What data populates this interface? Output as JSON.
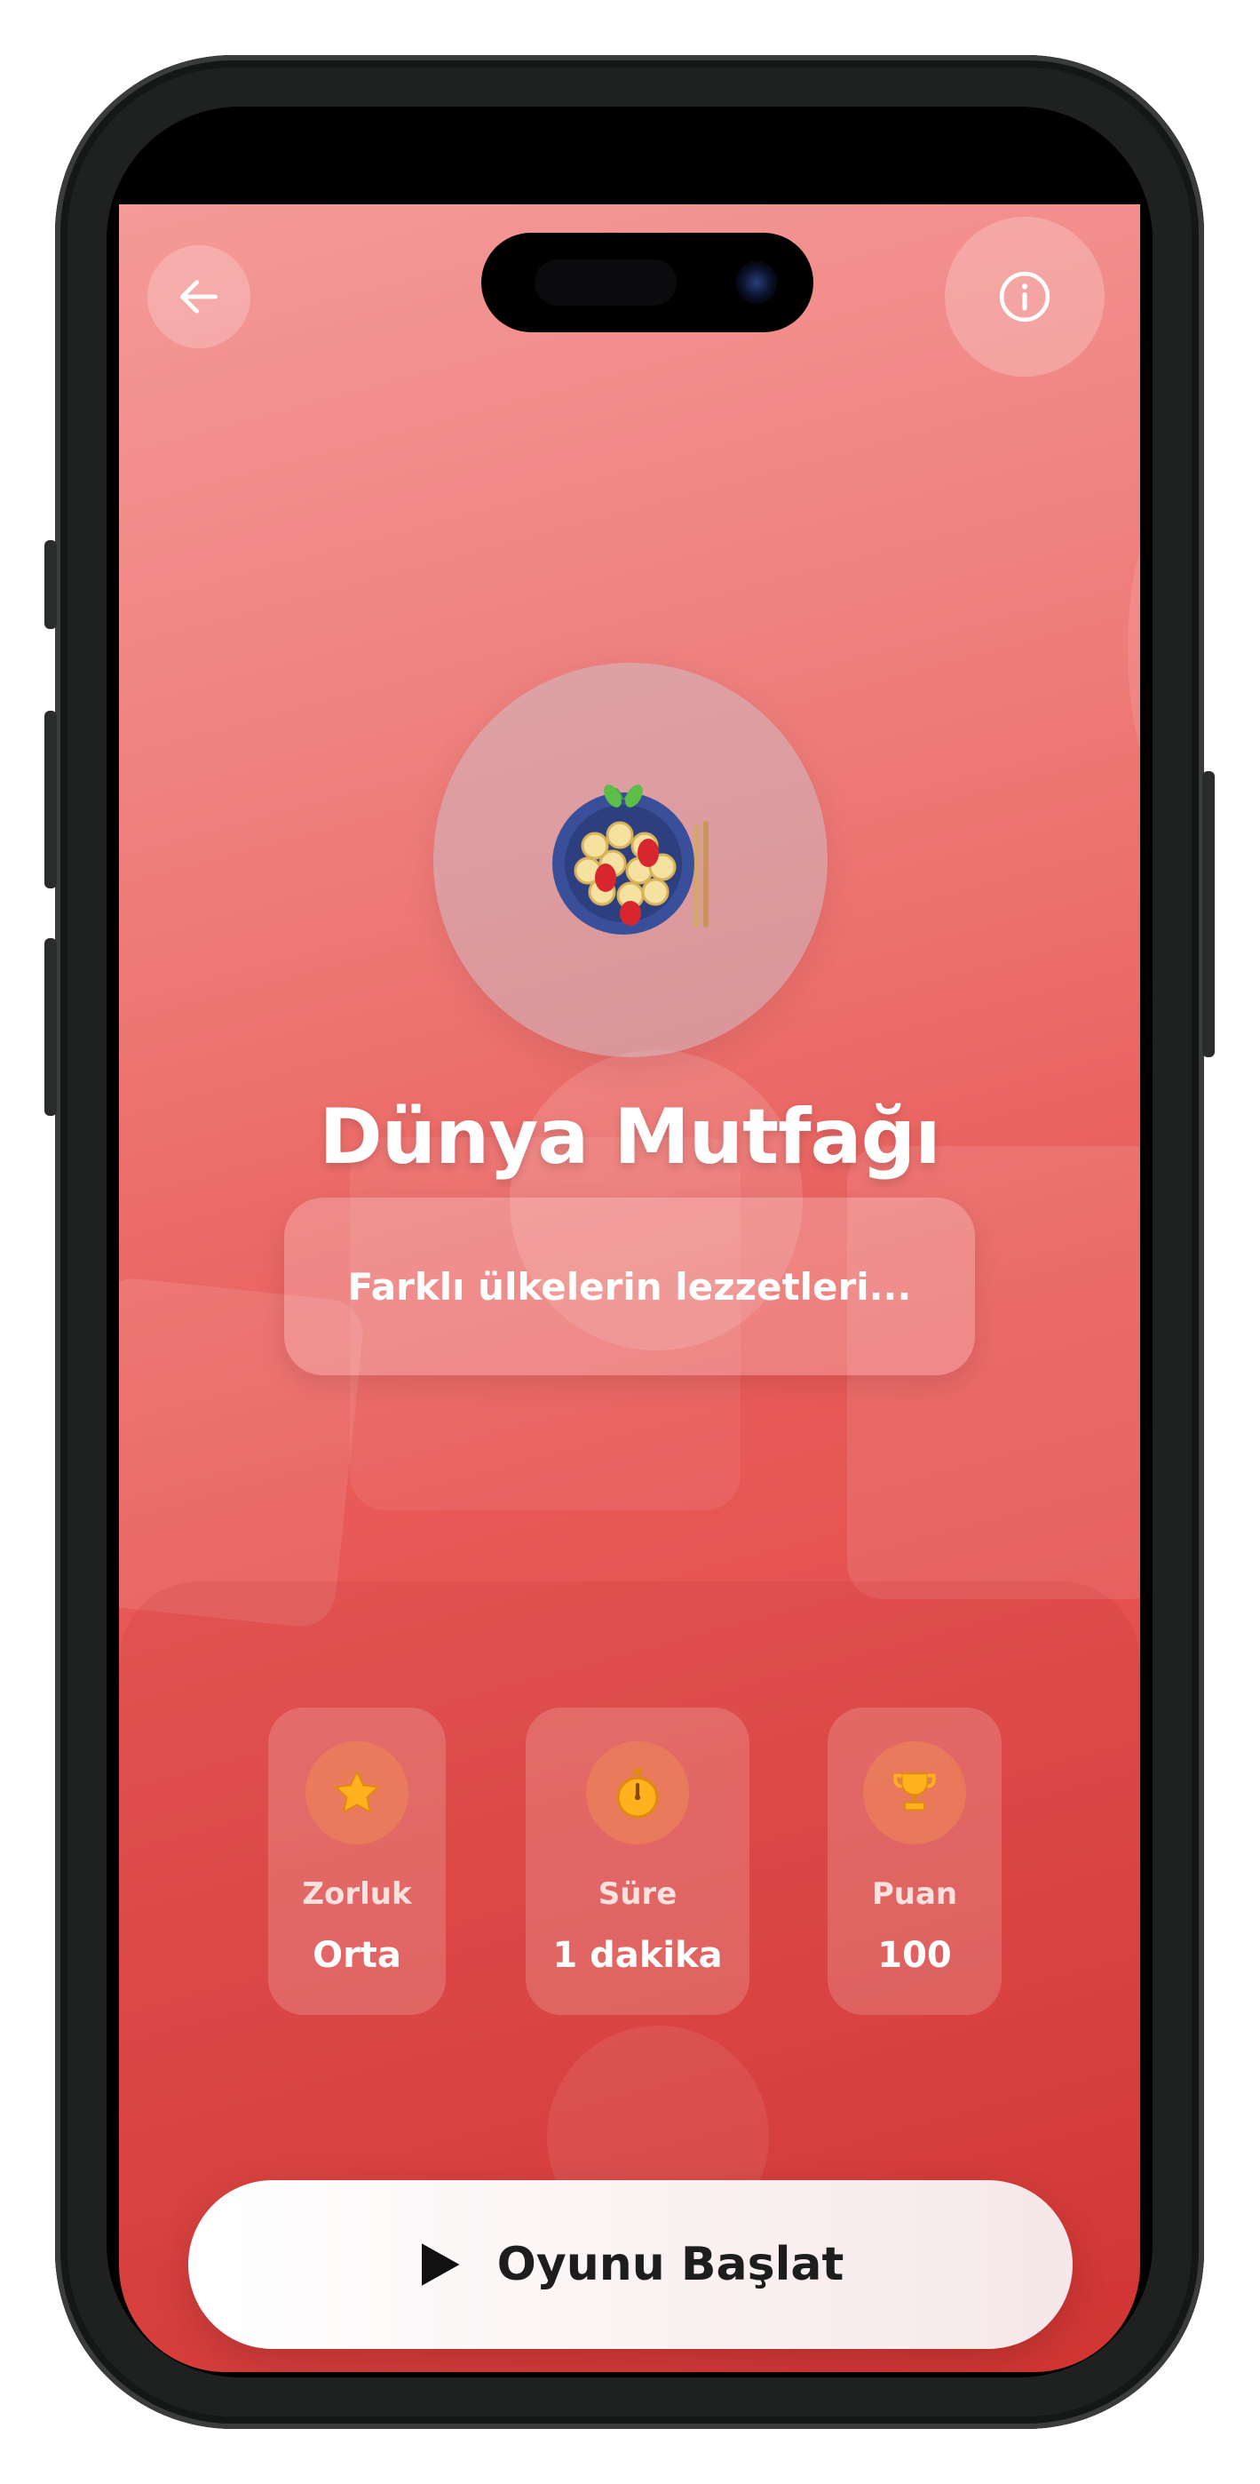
{
  "header": {
    "back_icon": "arrow-left-icon",
    "info_icon": "info-icon"
  },
  "hero": {
    "emoji_icon": "pasta-plate-icon",
    "title": "Dünya Mutfağı",
    "description": "Farklı ülkelerin lezzetleri..."
  },
  "stats": [
    {
      "icon": "star-icon",
      "label": "Zorluk",
      "value": "Orta"
    },
    {
      "icon": "stopwatch-icon",
      "label": "Süre",
      "value": "1 dakika"
    },
    {
      "icon": "trophy-icon",
      "label": "Puan",
      "value": "100"
    }
  ],
  "start_button": {
    "icon": "play-icon",
    "label": "Oyunu Başlat"
  },
  "colors": {
    "gradient_top": "#f49a98",
    "gradient_bottom": "#d63734",
    "icon_badge": "#ec805a",
    "icon_fill": "#ffb21e"
  }
}
